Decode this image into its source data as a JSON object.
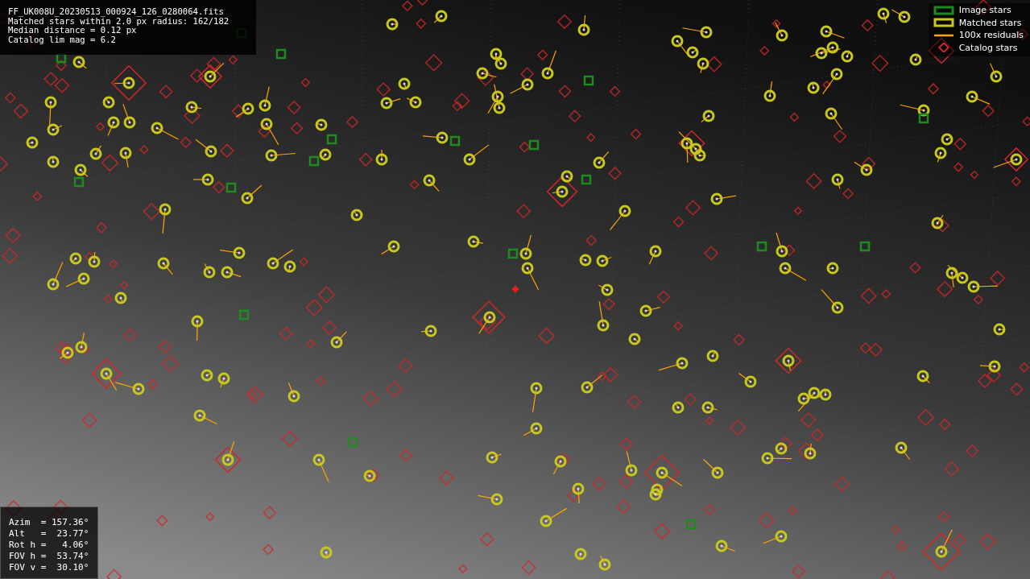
{
  "header_info": [
    "FF_UK008U_20230513_000924_126_0280064.fits",
    "Matched stars within 2.0 px radius: 162/182",
    "Median distance = 0.12 px",
    "Catalog lim mag = 6.2"
  ],
  "legend": [
    {
      "kind": "image",
      "label": "Image stars",
      "color": "#1f8a1f"
    },
    {
      "kind": "matched",
      "label": "Matched stars",
      "color": "#c8c81e"
    },
    {
      "kind": "residual",
      "label": "100x residuals",
      "color": "#ffa500"
    },
    {
      "kind": "catalog",
      "label": "Catalog stars",
      "color": "#d02828"
    }
  ],
  "pointing_info": [
    "Azim  = 157.36°",
    "Alt   =  23.77°",
    "Rot h =   4.06°",
    "FOV h =  53.74°",
    "FOV v =  30.10°"
  ]
}
